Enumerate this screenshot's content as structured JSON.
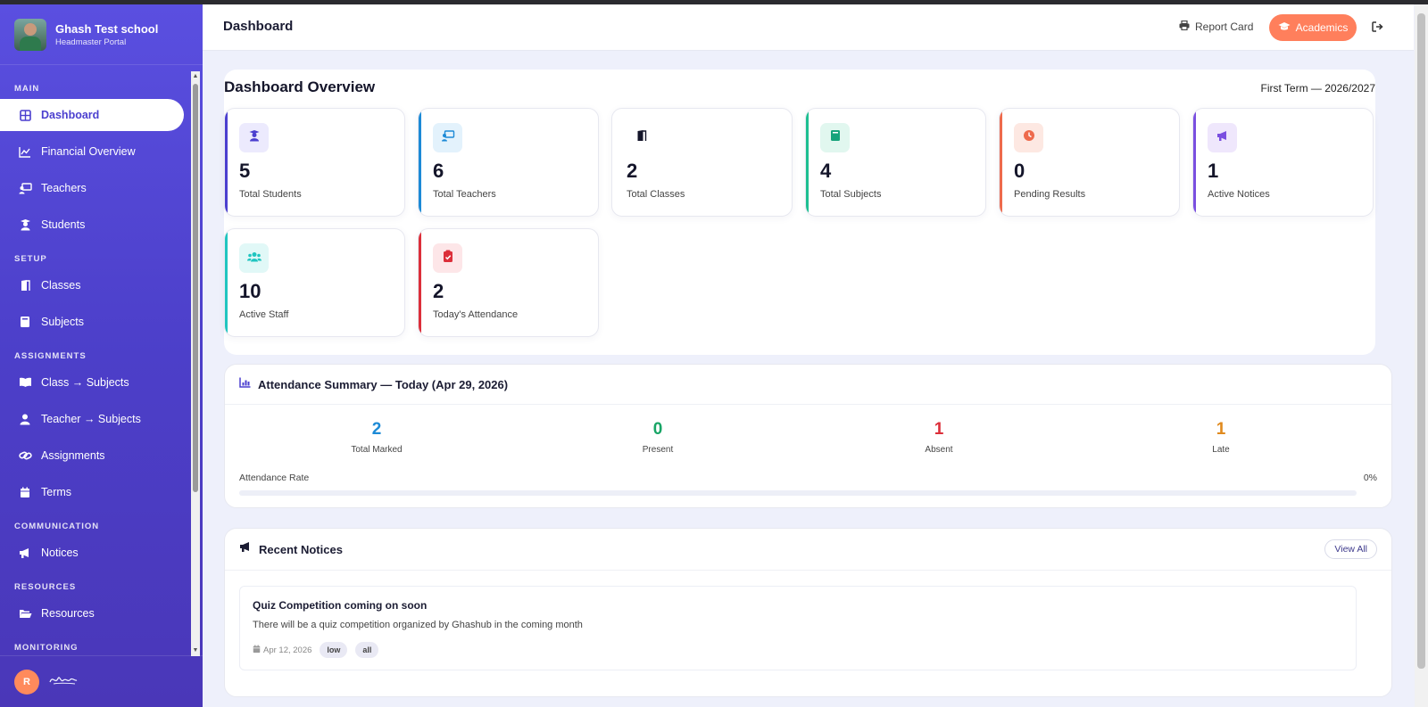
{
  "brand": {
    "name": "Ghash Test school",
    "subtitle": "Headmaster Portal"
  },
  "sidebar": {
    "sections": [
      {
        "title": "MAIN",
        "items": [
          {
            "label": "Dashboard",
            "icon": "dashboard-icon",
            "active": true
          },
          {
            "label": "Financial Overview",
            "icon": "chart-line-icon"
          },
          {
            "label": "Teachers",
            "icon": "chalkboard-teacher-icon"
          },
          {
            "label": "Students",
            "icon": "user-graduate-icon"
          }
        ]
      },
      {
        "title": "SETUP",
        "items": [
          {
            "label": "Classes",
            "icon": "door-icon"
          },
          {
            "label": "Subjects",
            "icon": "book-icon"
          }
        ]
      },
      {
        "title": "ASSIGNMENTS",
        "items": [
          {
            "label": "Class → Subjects",
            "icon": "book-open-icon"
          },
          {
            "label": "Teacher → Subjects",
            "icon": "user-icon"
          },
          {
            "label": "Assignments",
            "icon": "link-icon"
          },
          {
            "label": "Terms",
            "icon": "calendar-icon"
          }
        ]
      },
      {
        "title": "COMMUNICATION",
        "items": [
          {
            "label": "Notices",
            "icon": "megaphone-icon"
          }
        ]
      },
      {
        "title": "RESOURCES",
        "items": [
          {
            "label": "Resources",
            "icon": "folder-open-icon"
          }
        ]
      },
      {
        "title": "MONITORING",
        "items": []
      }
    ],
    "user_initial": "R"
  },
  "header": {
    "title": "Dashboard",
    "report_card_label": "Report Card",
    "academics_label": "Academics"
  },
  "overview": {
    "title": "Dashboard Overview",
    "term": "First Term — 2026/2027",
    "stats": [
      {
        "value": "5",
        "label": "Total Students",
        "icon": "user-graduate-icon",
        "accent": "#4b3fcf",
        "icon_bg": "#eceafd",
        "icon_color": "#4b3fcf"
      },
      {
        "value": "6",
        "label": "Total Teachers",
        "icon": "chalkboard-teacher-icon",
        "accent": "#1c8ad6",
        "icon_bg": "#e3f2fc",
        "icon_color": "#1c8ad6"
      },
      {
        "value": "2",
        "label": "Total Classes",
        "icon": "door-icon",
        "accent": "",
        "icon_bg": "#ffffff",
        "icon_color": "#14152a"
      },
      {
        "value": "4",
        "label": "Total Subjects",
        "icon": "book-icon",
        "accent": "#1dbf91",
        "icon_bg": "#e1f7ef",
        "icon_color": "#16a37b"
      },
      {
        "value": "0",
        "label": "Pending Results",
        "icon": "clock-icon",
        "accent": "#ee6a4c",
        "icon_bg": "#fde8e2",
        "icon_color": "#ee6a4c"
      },
      {
        "value": "1",
        "label": "Active Notices",
        "icon": "megaphone-icon",
        "accent": "#7a4fe0",
        "icon_bg": "#efe7fc",
        "icon_color": "#7a4fe0"
      },
      {
        "value": "10",
        "label": "Active Staff",
        "icon": "users-icon",
        "accent": "#20c5c0",
        "icon_bg": "#e1f8f7",
        "icon_color": "#20c5c0"
      },
      {
        "value": "2",
        "label": "Today's Attendance",
        "icon": "clipboard-check-icon",
        "accent": "#dc2f3a",
        "icon_bg": "#fde6e8",
        "icon_color": "#dc2f3a"
      }
    ]
  },
  "attendance": {
    "title": "Attendance Summary — Today (Apr 29, 2026)",
    "stats": [
      {
        "value": "2",
        "label": "Total Marked",
        "color": "#1c8ad6"
      },
      {
        "value": "0",
        "label": "Present",
        "color": "#18a566"
      },
      {
        "value": "1",
        "label": "Absent",
        "color": "#dc2f3a"
      },
      {
        "value": "1",
        "label": "Late",
        "color": "#e08a1e"
      }
    ],
    "rate_label": "Attendance Rate",
    "rate_text": "0%",
    "rate_fraction": 0
  },
  "notices": {
    "title": "Recent Notices",
    "view_all_label": "View All",
    "items": [
      {
        "title": "Quiz Competition coming on soon",
        "body": "There will be a quiz competition organized by Ghashub in the coming month",
        "date": "Apr 12, 2026",
        "priority": "low",
        "audience": "all"
      }
    ]
  }
}
